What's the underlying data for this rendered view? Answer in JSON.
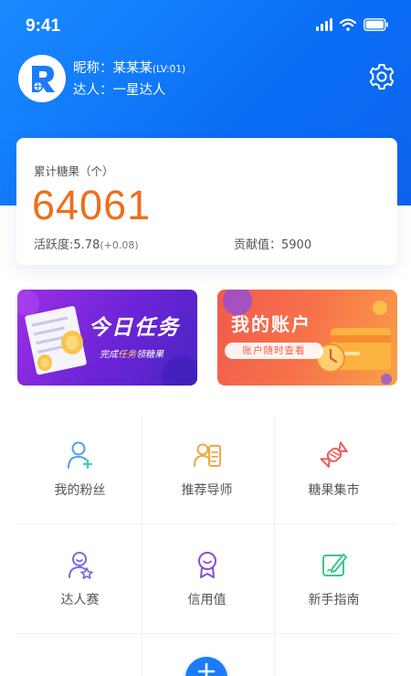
{
  "status_bar": {
    "time": "9:41",
    "icons": [
      "signal-icon",
      "wifi-icon",
      "battery-icon"
    ]
  },
  "profile": {
    "nickname_label": "昵称：",
    "nickname": "某某某",
    "level": "(LV:01)",
    "rank_label": "达人：",
    "rank": "一星达人",
    "avatar_icon": "app-logo-r",
    "settings_icon": "gear-icon"
  },
  "stats": {
    "candy_label": "累计糖果（个）",
    "candy_value": "64061",
    "activity_label": "活跃度:",
    "activity_value": "5.78",
    "activity_delta": "(+0.08)",
    "contribution_label": "贡献值：",
    "contribution_value": "5900"
  },
  "banners": {
    "task": {
      "title": "今日任务",
      "subtitle_prefix": "完成",
      "subtitle_highlight": "任务",
      "subtitle_suffix": "领糖果"
    },
    "account": {
      "title": "我的账户",
      "button": "账户随时查看"
    }
  },
  "menu": [
    {
      "label": "我的粉丝",
      "icon": "add-user-icon"
    },
    {
      "label": "推荐导师",
      "icon": "id-card-icon"
    },
    {
      "label": "糖果集市",
      "icon": "candy-icon"
    },
    {
      "label": "达人赛",
      "icon": "user-star-icon"
    },
    {
      "label": "信用值",
      "icon": "award-ribbon-icon"
    },
    {
      "label": "新手指南",
      "icon": "edit-note-icon"
    }
  ],
  "fab": {
    "label": "+"
  },
  "colors": {
    "primary": "#1a7cf6",
    "accent_orange": "#f06d1a",
    "task_purple": "#7a28dc",
    "account_orange": "#f5654a"
  }
}
